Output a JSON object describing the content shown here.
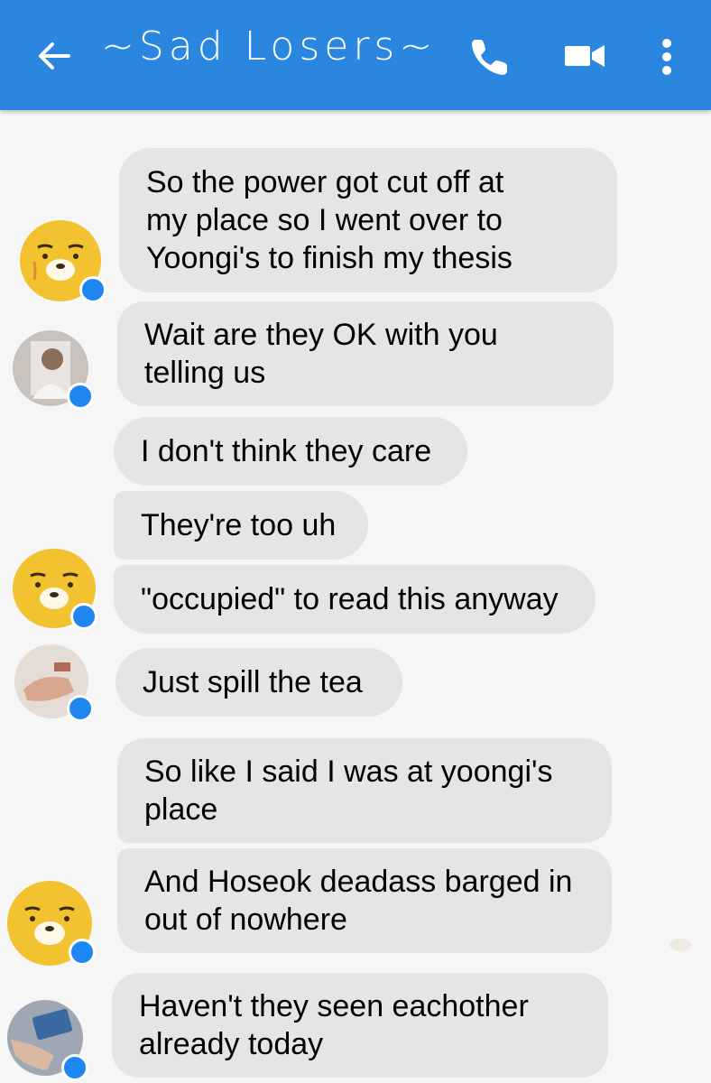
{
  "header": {
    "title": "~Sad Losers~",
    "color": "#2b86e0",
    "icons": [
      "back-arrow-icon",
      "phone-icon",
      "video-camera-icon",
      "more-vert-icon"
    ]
  },
  "messages": [
    {
      "sender_avatar": "yellow-bear",
      "lines": [
        "So the power got cut off at",
        "my place so I went over to",
        "Yoongi's to finish my thesis"
      ]
    },
    {
      "sender_avatar": "photo-person",
      "lines": [
        "Wait are they OK with you",
        "telling us"
      ]
    },
    {
      "sender_avatar": "photo-person",
      "lines": [
        "I don't think they care"
      ]
    },
    {
      "sender_avatar": "yellow-bear",
      "lines": [
        "They're too uh"
      ]
    },
    {
      "sender_avatar": "yellow-bear",
      "lines": [
        "\"occupied\" to read this anyway"
      ]
    },
    {
      "sender_avatar": "photo-hands",
      "lines": [
        "Just spill the tea"
      ]
    },
    {
      "sender_avatar": "yellow-bear",
      "lines": [
        "So like I said I was at yoongi's",
        "place"
      ]
    },
    {
      "sender_avatar": "yellow-bear",
      "lines": [
        "And Hoseok deadass barged in",
        "out of nowhere"
      ]
    },
    {
      "sender_avatar": "photo-phone",
      "lines": [
        "Haven't they seen eachother",
        "already today"
      ]
    }
  ]
}
